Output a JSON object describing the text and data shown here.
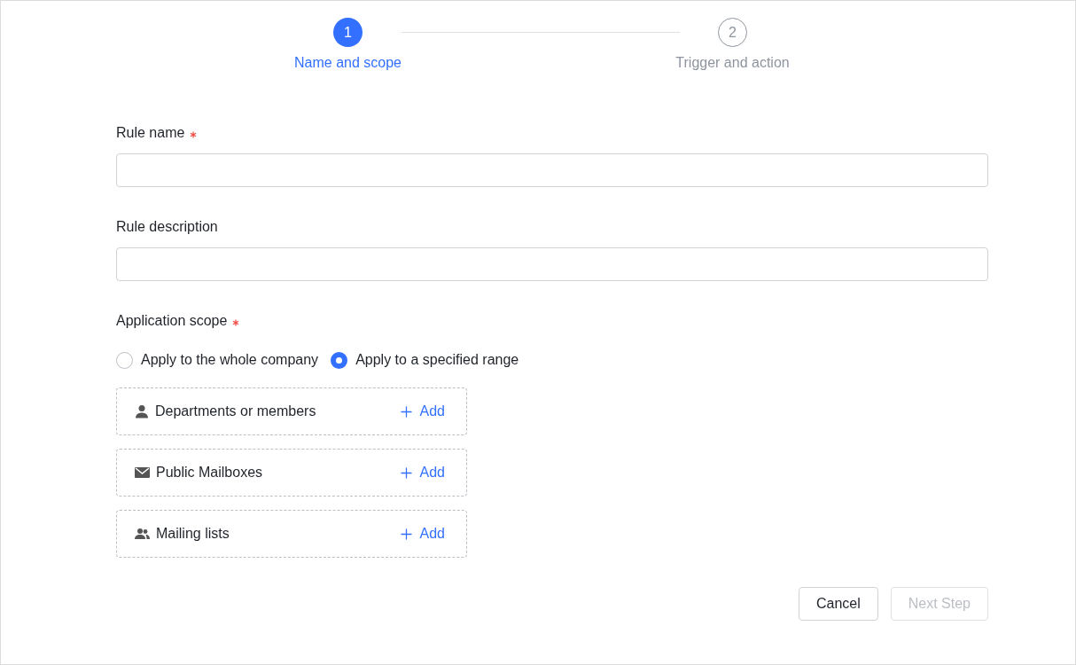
{
  "steps": [
    {
      "number": "1",
      "label": "Name and scope",
      "selected": true
    },
    {
      "number": "2",
      "label": "Trigger and action",
      "selected": false
    }
  ],
  "fields": [
    {
      "label": "Rule name",
      "required": true
    },
    {
      "label": "Rule description",
      "required": false
    }
  ],
  "scope": {
    "label": "Application scope",
    "required": true,
    "options": [
      {
        "label": "Apply to the whole company",
        "selected": false
      },
      {
        "label": "Apply to a specified range",
        "selected": true
      }
    ],
    "targets": [
      {
        "kind": "person",
        "label": "Departments or members",
        "action": "Add"
      },
      {
        "kind": "mail",
        "label": "Public Mailboxes",
        "action": "Add"
      },
      {
        "kind": "group",
        "label": "Mailing lists",
        "action": "Add"
      }
    ]
  },
  "buttons": [
    {
      "label": "Cancel",
      "disabled": false
    },
    {
      "label": "Next Step",
      "disabled": true
    }
  ]
}
